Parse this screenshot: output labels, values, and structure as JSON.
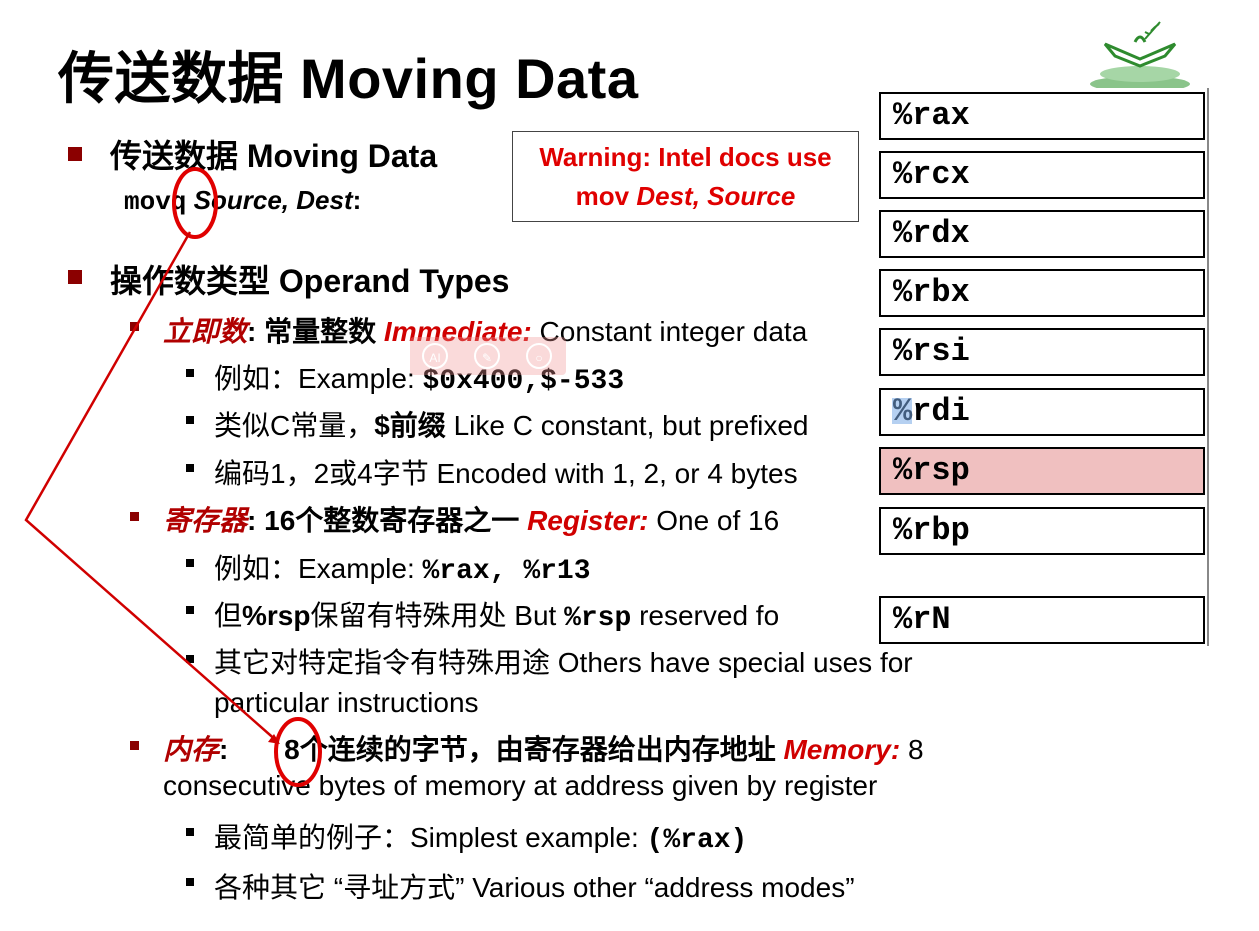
{
  "title": "传送数据 Moving Data",
  "section1": {
    "heading": "传送数据 Moving Data",
    "instr": "movq",
    "args": "Source, Dest",
    "colon": ":"
  },
  "warning": {
    "line1": "Warning: Intel docs use",
    "line2_prefix": "mov ",
    "line2_italic": "Dest, Source"
  },
  "section2": {
    "heading": "操作数类型 Operand Types",
    "immediate": {
      "zh": "立即数",
      "colon": ":",
      "zh2": "常量整数",
      "en": "Immediate:",
      "desc": " Constant integer data",
      "ex1_zh": "例如：Example: ",
      "ex1_code": "$0x400,$-533",
      "ex2_zh": "类似C常量，",
      "ex2_bold": "$前缀",
      "ex2_en": " Like C constant, but prefixed",
      "ex3": "编码1，2或4字节 Encoded with 1, 2, or 4 bytes"
    },
    "register": {
      "zh": "寄存器",
      "colon": ":",
      "zh2": "16个整数寄存器之一",
      "en": "Register:",
      "desc": " One of 16",
      "ex1_zh": "例如：Example: ",
      "ex1_code": "%rax, %r13",
      "ex2_pre": "但",
      "ex2_bold": "%rsp",
      "ex2_mid": "保留有特殊用处 But ",
      "ex2_code": "%rsp",
      "ex2_en": "  reserved fo",
      "ex3_line1": "其它对特定指令有特殊用途 Others have special uses for",
      "ex3_line2": "particular instructions"
    },
    "memory": {
      "zh": "内存",
      "colon": ":",
      "zh2": "8个连续的字节，由寄存器给出内存地址",
      "en": "Memory:",
      "desc": " 8",
      "desc_line2": "consecutive bytes of memory at address given by register",
      "ex1_zh": "最简单的例子：Simplest example: ",
      "ex1_code": "(%rax)",
      "ex2": "各种其它 “寻址方式”  Various other “address modes”"
    }
  },
  "registers": [
    "%rax",
    "%rcx",
    "%rdx",
    "%rbx",
    "%rsi",
    "%rdi",
    "%rsp",
    "%rbp",
    "%rN"
  ],
  "highlight_register": "%rsp",
  "overlay_icons": [
    "ai-icon",
    "pen-icon",
    "search-icon"
  ],
  "colors": {
    "accent_red": "#e00000",
    "bullet": "#8b0000",
    "highlight": "#f0c0c0",
    "annotation": "#e00000"
  }
}
